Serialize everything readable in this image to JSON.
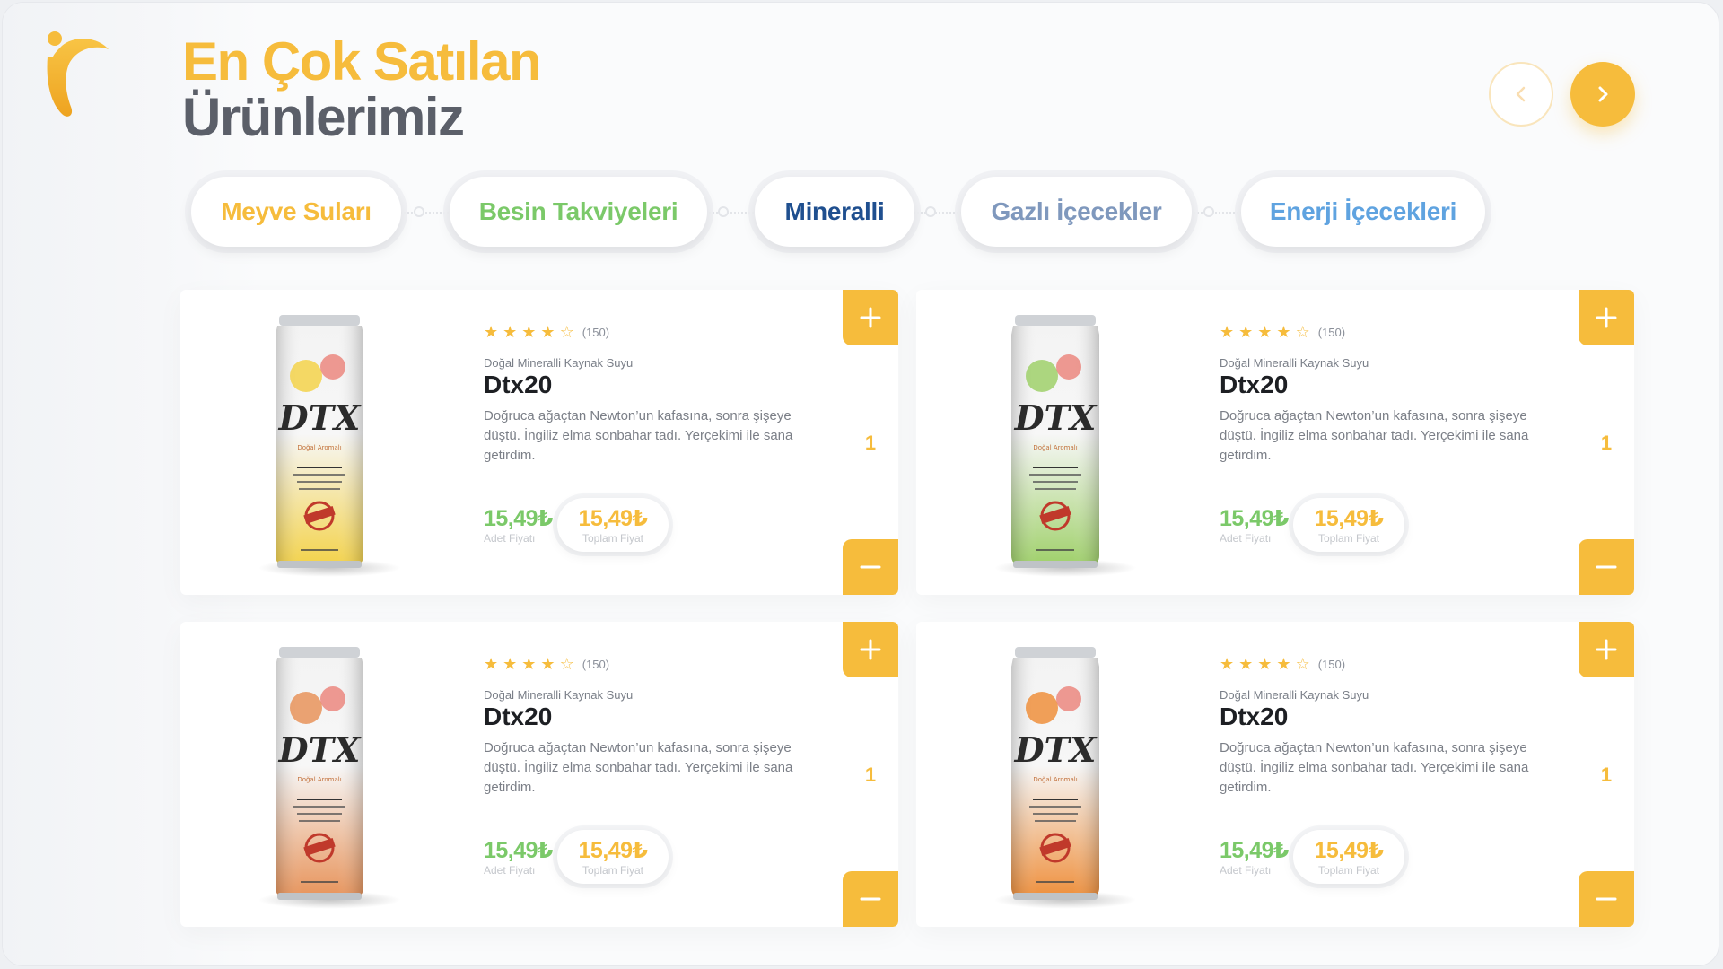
{
  "section": {
    "title_line1": "En Çok Satılan",
    "title_line2": "Ürünlerimiz"
  },
  "colors": {
    "accent": "#f6bc3c",
    "green": "#7bc969",
    "dark_text": "#5b5f69"
  },
  "nav": {
    "prev_icon": "chevron-left-icon",
    "next_icon": "chevron-right-icon"
  },
  "tabs": [
    {
      "label": "Meyve Suları",
      "color": "#f6bc3c"
    },
    {
      "label": "Besin Takviyeleri",
      "color": "#7bc969"
    },
    {
      "label": "Mineralli",
      "color": "#1f4f8f"
    },
    {
      "label": "Gazlı İçecekler",
      "color": "#7f98bd"
    },
    {
      "label": "Enerji İçecekleri",
      "color": "#5fa3e0"
    }
  ],
  "products": [
    {
      "rating_count": "(150)",
      "rating": 4,
      "subtitle": "Doğal Mineralli Kaynak Suyu",
      "name": "Dtx20",
      "description": "Doğruca ağaçtan Newton’un kafasına, sonra şişeye düştü. İngiliz elma sonbahar tadı. Yerçekimi ile sana getirdim.",
      "unit_price": "15,49₺",
      "unit_label": "Adet Fiyatı",
      "total_price": "15,49₺",
      "total_label": "Toplam Fiyat",
      "quantity": "1",
      "can_color": "#f3d24a"
    },
    {
      "rating_count": "(150)",
      "rating": 4,
      "subtitle": "Doğal Mineralli Kaynak Suyu",
      "name": "Dtx20",
      "description": "Doğruca ağaçtan Newton’un kafasına, sonra şişeye düştü. İngiliz elma sonbahar tadı. Yerçekimi ile sana getirdim.",
      "unit_price": "15,49₺",
      "unit_label": "Adet Fiyatı",
      "total_price": "15,49₺",
      "total_label": "Toplam Fiyat",
      "quantity": "1",
      "can_color": "#9fd06a"
    },
    {
      "rating_count": "(150)",
      "rating": 4,
      "subtitle": "Doğal Mineralli Kaynak Suyu",
      "name": "Dtx20",
      "description": "Doğruca ağaçtan Newton’un kafasına, sonra şişeye düştü. İngiliz elma sonbahar tadı. Yerçekimi ile sana getirdim.",
      "unit_price": "15,49₺",
      "unit_label": "Adet Fiyatı",
      "total_price": "15,49₺",
      "total_label": "Toplam Fiyat",
      "quantity": "1",
      "can_color": "#e7935a"
    },
    {
      "rating_count": "(150)",
      "rating": 4,
      "subtitle": "Doğal Mineralli Kaynak Suyu",
      "name": "Dtx20",
      "description": "Doğruca ağaçtan Newton’un kafasına, sonra şişeye düştü. İngiliz elma sonbahar tadı. Yerçekimi ile sana getirdim.",
      "unit_price": "15,49₺",
      "unit_label": "Adet Fiyatı",
      "total_price": "15,49₺",
      "total_label": "Toplam Fiyat",
      "quantity": "1",
      "can_color": "#ee8f3c"
    }
  ]
}
